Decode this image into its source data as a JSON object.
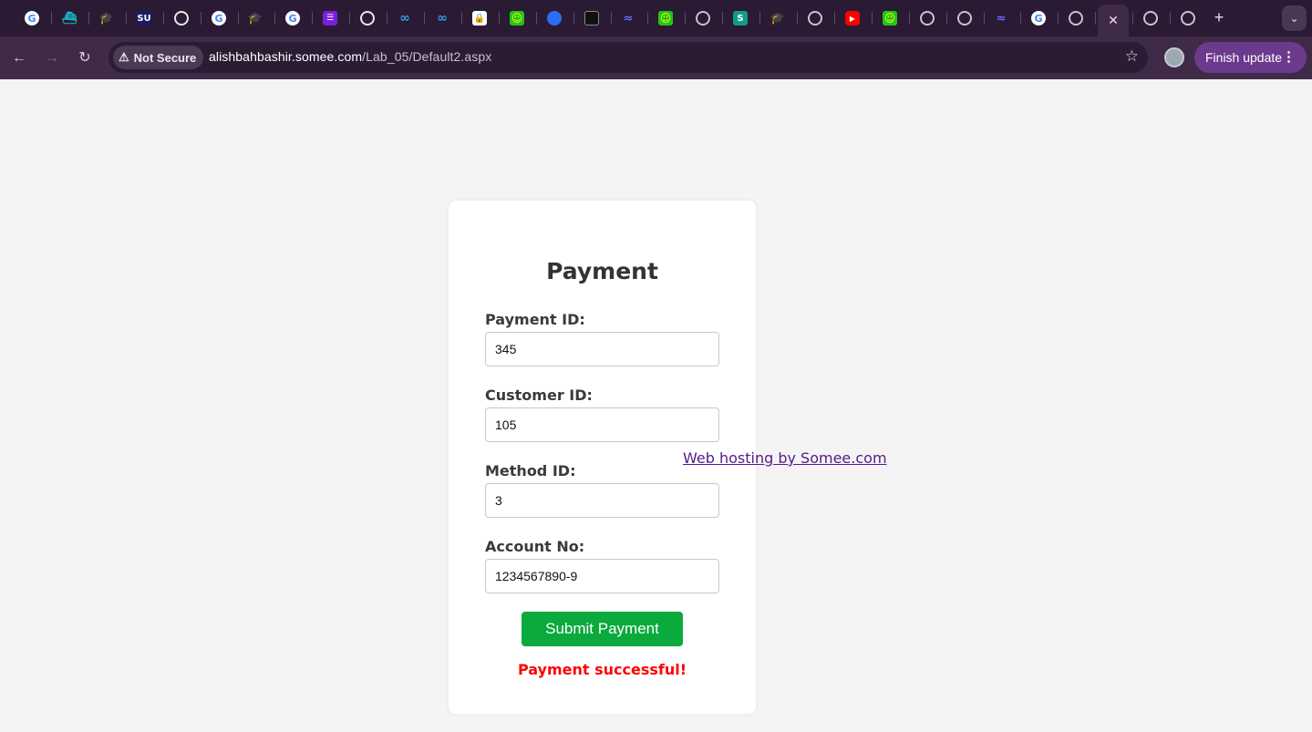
{
  "browser": {
    "tabs": [
      {
        "icon": "google-icon",
        "glyph": "G"
      },
      {
        "icon": "ship-icon",
        "glyph": "⛴"
      },
      {
        "icon": "graduation-cap-icon",
        "glyph": "🎓"
      },
      {
        "icon": "su-logo-icon",
        "glyph": "SU"
      },
      {
        "icon": "chatgpt-icon",
        "glyph": ""
      },
      {
        "icon": "google-icon",
        "glyph": "G"
      },
      {
        "icon": "graduation-cap-icon",
        "glyph": "🎓"
      },
      {
        "icon": "google-icon",
        "glyph": "G"
      },
      {
        "icon": "list-icon",
        "glyph": "☰"
      },
      {
        "icon": "chatgpt-icon",
        "glyph": ""
      },
      {
        "icon": "link-icon",
        "glyph": "∞"
      },
      {
        "icon": "link-icon",
        "glyph": "∞"
      },
      {
        "icon": "lock-icon",
        "glyph": "🔒"
      },
      {
        "icon": "smiley-icon",
        "glyph": "☺"
      },
      {
        "icon": "ring-icon",
        "glyph": ""
      },
      {
        "icon": "document-icon",
        "glyph": ""
      },
      {
        "icon": "wave-icon",
        "glyph": "≈"
      },
      {
        "icon": "smiley-icon",
        "glyph": "☺"
      },
      {
        "icon": "globe-icon",
        "glyph": ""
      },
      {
        "icon": "s-logo-icon",
        "glyph": "S"
      },
      {
        "icon": "graduation-cap-icon",
        "glyph": "🎓"
      },
      {
        "icon": "globe-icon",
        "glyph": ""
      },
      {
        "icon": "youtube-icon",
        "glyph": "▶"
      },
      {
        "icon": "smiley-icon",
        "glyph": "☺"
      },
      {
        "icon": "globe-icon",
        "glyph": ""
      },
      {
        "icon": "globe-icon",
        "glyph": ""
      },
      {
        "icon": "wave-icon",
        "glyph": "≈"
      },
      {
        "icon": "google-icon",
        "glyph": "G"
      },
      {
        "icon": "globe-icon",
        "glyph": ""
      },
      {
        "icon": "close-icon",
        "glyph": "✕",
        "active": true
      },
      {
        "icon": "globe-icon",
        "glyph": ""
      },
      {
        "icon": "globe-icon",
        "glyph": ""
      }
    ],
    "new_tab_glyph": "+",
    "tab_search_glyph": "⌄",
    "back_glyph": "←",
    "forward_glyph": "→",
    "reload_glyph": "↻",
    "security_label": "Not Secure",
    "warning_glyph": "⚠",
    "url_host": "alishbahbashir.somee.com",
    "url_path": "/Lab_05/Default2.aspx",
    "star_glyph": "☆",
    "finish_update_label": "Finish update",
    "menu_glyph": "⋮"
  },
  "form": {
    "title": "Payment",
    "fields": [
      {
        "label": "Payment ID:",
        "value": "345"
      },
      {
        "label": "Customer ID:",
        "value": "105"
      },
      {
        "label": "Method ID:",
        "value": "3"
      },
      {
        "label": "Account No:",
        "value": "1234567890-9"
      }
    ],
    "submit_label": "Submit Payment",
    "status_message": "Payment successful!"
  },
  "hosting_link": "Web hosting by Somee.com",
  "colors": {
    "tabstrip_bg": "#2b1a33",
    "toolbar_bg": "#3f2a47",
    "finish_update_bg": "#6c3a8c",
    "submit_bg": "#0aaa3c",
    "success_text": "#ff0000",
    "link_visited": "#551a8b"
  }
}
